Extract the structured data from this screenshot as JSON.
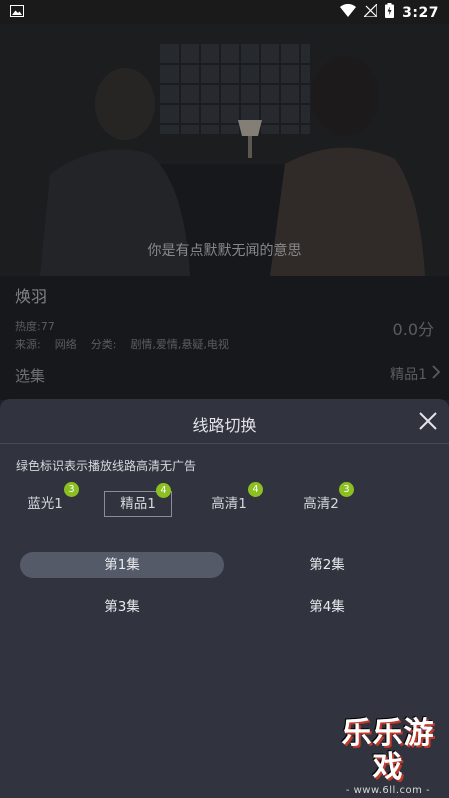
{
  "status_bar": {
    "time": "3:27"
  },
  "video": {
    "subtitle": "你是有点默默无闻的意思"
  },
  "details": {
    "title": "焕羽",
    "heat_label": "热度:",
    "heat_value": "77",
    "source_label": "来源:",
    "source_value": "网络",
    "category_label": "分类:",
    "category_value": "剧情,爱情,悬疑,电视",
    "score": "0.0分",
    "episodes_label": "选集",
    "episodes_current": "精品1"
  },
  "sheet": {
    "title": "线路切换",
    "notice": "绿色标识表示播放线路高清无广告",
    "sources": [
      {
        "label": "蓝光1",
        "count": "3"
      },
      {
        "label": "精品1",
        "count": "4"
      },
      {
        "label": "高清1",
        "count": "4"
      },
      {
        "label": "高清2",
        "count": "3"
      }
    ],
    "episodes": [
      "第1集",
      "第2集",
      "第3集",
      "第4集"
    ]
  },
  "watermark": {
    "main": "乐乐游戏",
    "url": "- www.6ll.com -"
  },
  "colors": {
    "badge_green": "#8cc022",
    "sheet_bg": "#31343e",
    "active_episode_bg": "#555a68"
  }
}
